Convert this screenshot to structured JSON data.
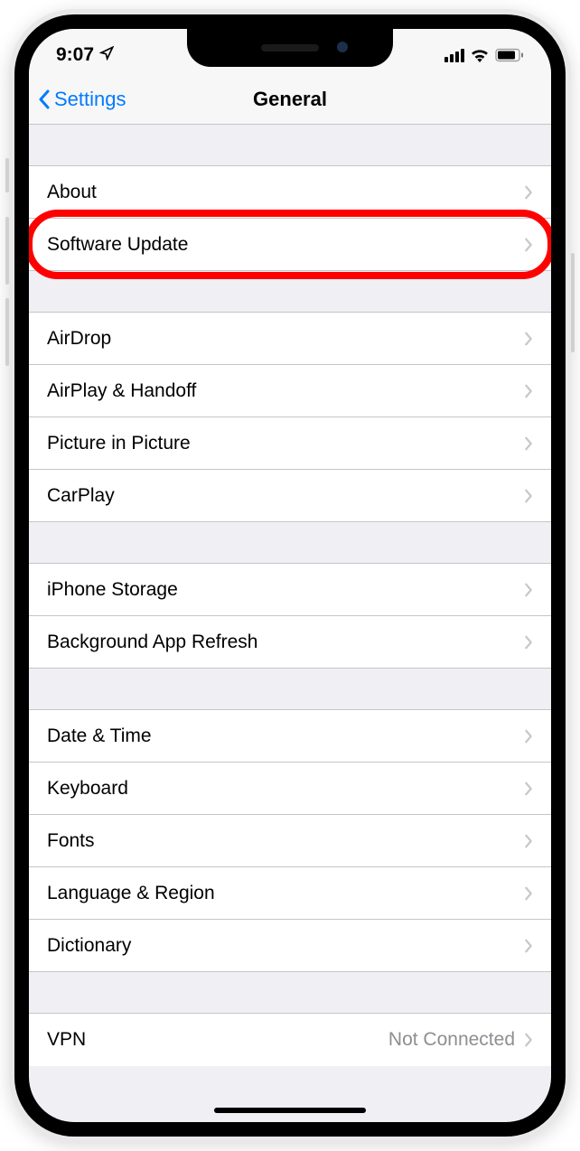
{
  "status_bar": {
    "time": "9:07"
  },
  "nav": {
    "back_label": "Settings",
    "title": "General"
  },
  "sections": {
    "group1": {
      "about": "About",
      "software_update": "Software Update"
    },
    "group2": {
      "airdrop": "AirDrop",
      "airplay_handoff": "AirPlay & Handoff",
      "pip": "Picture in Picture",
      "carplay": "CarPlay"
    },
    "group3": {
      "iphone_storage": "iPhone Storage",
      "background_refresh": "Background App Refresh"
    },
    "group4": {
      "date_time": "Date & Time",
      "keyboard": "Keyboard",
      "fonts": "Fonts",
      "language_region": "Language & Region",
      "dictionary": "Dictionary"
    },
    "group5": {
      "vpn": "VPN",
      "vpn_status": "Not Connected"
    }
  }
}
